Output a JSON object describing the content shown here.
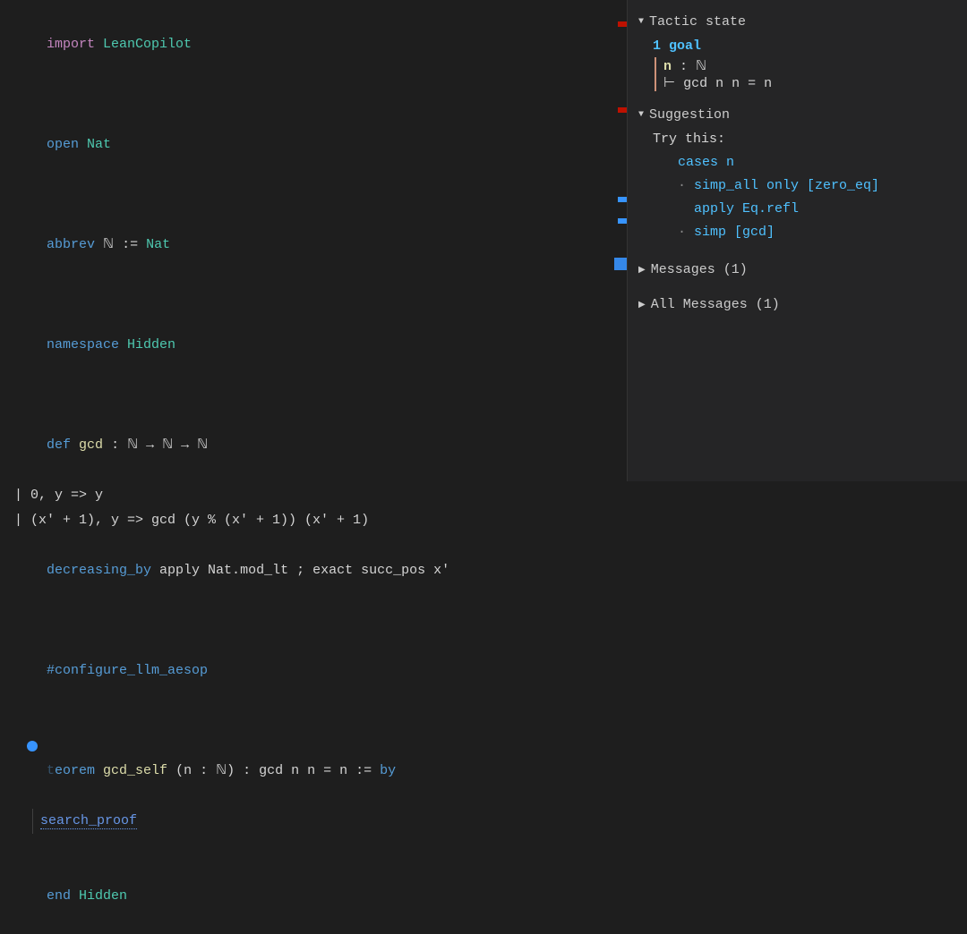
{
  "code": {
    "l1_import": "import",
    "l1_mod": "LeanCopilot",
    "l3_open": "open",
    "l3_ns": "Nat",
    "l5_abbrev": "abbrev",
    "l5_sym": "ℕ",
    "l5_assign": ":=",
    "l5_val": "Nat",
    "l7_namespace": "namespace",
    "l7_name": "Hidden",
    "l9_def": "def",
    "l9_name": "gcd",
    "l9_sig": " : ℕ → ℕ → ℕ",
    "l10": "| 0, y => y",
    "l11": "| (x' + 1), y => gcd (y % (x' + 1)) (x' + 1)",
    "l12_dec": "decreasing_by",
    "l12_rest": " apply Nat.mod_lt ; exact succ_pos x'",
    "l14_cmd": "#configure_llm_aesop",
    "l16_thm": "theorem",
    "l16_lead": "t",
    "l16_name": " gcd_self",
    "l16_sig": " (n : ℕ) : gcd n n = n := ",
    "l16_by": "by",
    "l17_tac": "search_proof",
    "l19_end": "end",
    "l19_name": "Hidden"
  },
  "infoview": {
    "tactic_state_header": "Tactic state",
    "goal_count": "1 goal",
    "hyp_name": "n",
    "hyp_colon": " : ",
    "hyp_type": "ℕ",
    "turnstile": "⊢ ",
    "goal": "gcd n n = n",
    "suggestion_header": "Suggestion",
    "try_this": "Try this:",
    "s1": "cases n",
    "s2a": "simp_all only ",
    "s2b": "[zero_eq]",
    "s3": "apply Eq.refl",
    "s4a": "simp ",
    "s4b": "[gcd]",
    "messages_header": "Messages (1)",
    "all_messages_header": "All Messages (1)"
  }
}
